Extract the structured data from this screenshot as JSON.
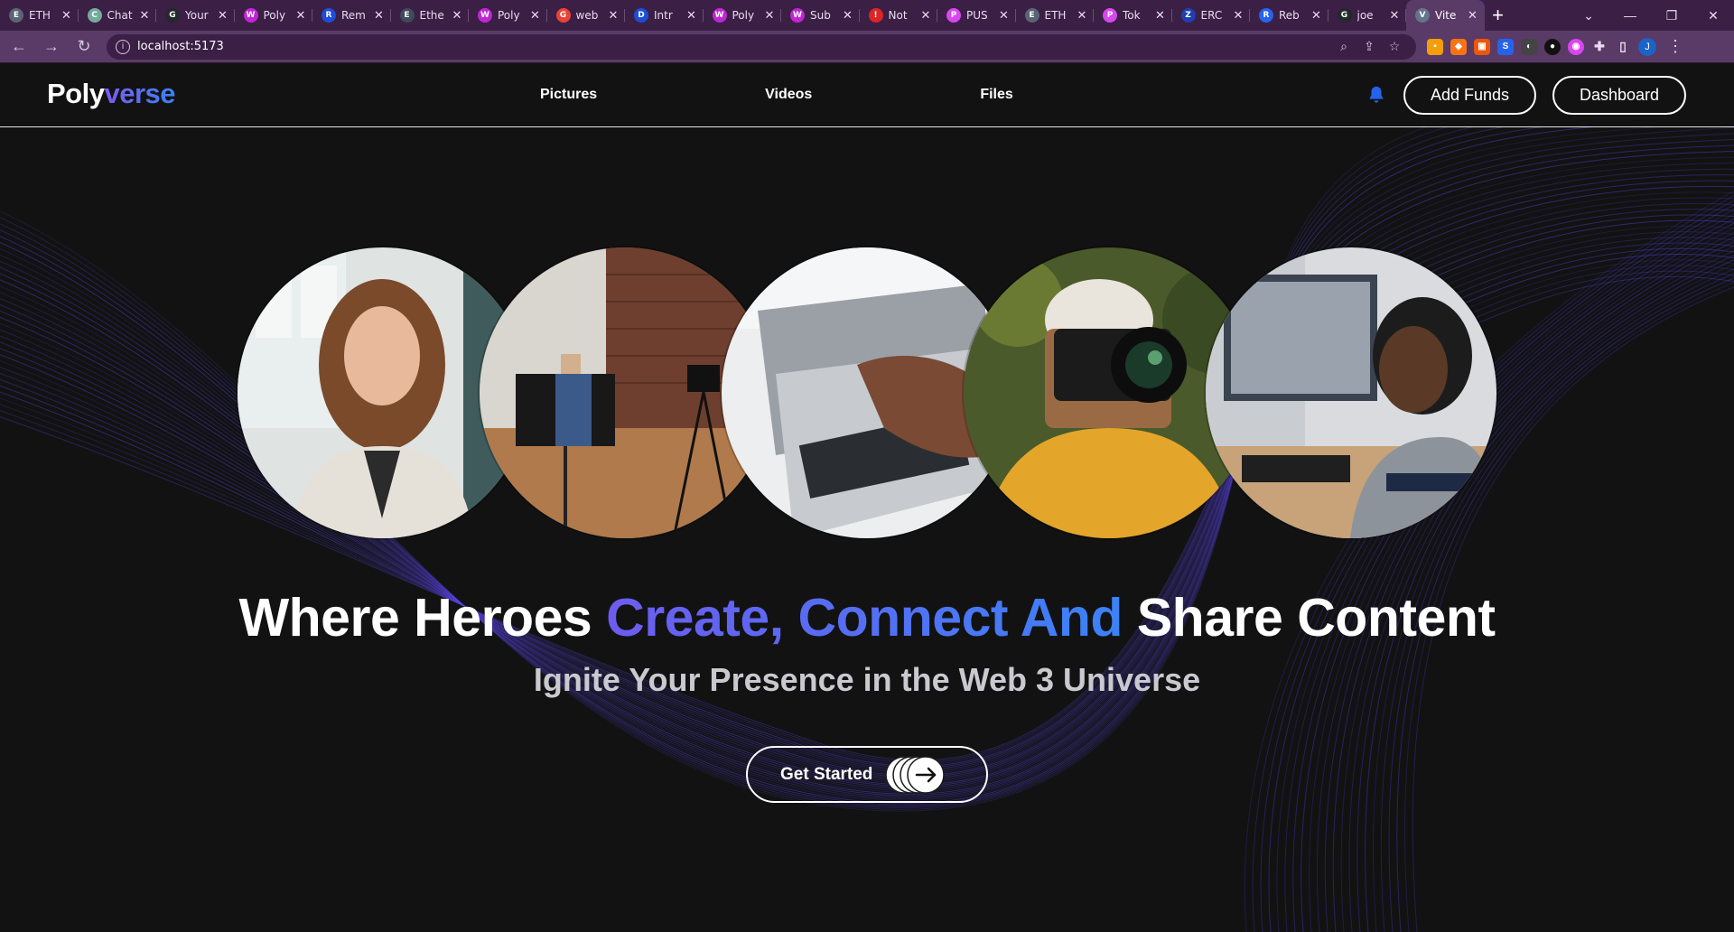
{
  "browser": {
    "tabs": [
      {
        "title": "ETH",
        "favicon_color": "#5a6473",
        "favicon_glyph": "E"
      },
      {
        "title": "Chat",
        "favicon_color": "#74aa9c",
        "favicon_glyph": "C"
      },
      {
        "title": "Your",
        "favicon_color": "#24292e",
        "favicon_glyph": "G"
      },
      {
        "title": "Poly",
        "favicon_color": "#c026d3",
        "favicon_glyph": "W"
      },
      {
        "title": "Rem",
        "favicon_color": "#1d4ed8",
        "favicon_glyph": "R"
      },
      {
        "title": "Ethe",
        "favicon_color": "#3f4a5a",
        "favicon_glyph": "E"
      },
      {
        "title": "Poly",
        "favicon_color": "#c026d3",
        "favicon_glyph": "W"
      },
      {
        "title": "web",
        "favicon_color": "#ea4335",
        "favicon_glyph": "G"
      },
      {
        "title": "Intr",
        "favicon_color": "#1d4ed8",
        "favicon_glyph": "D"
      },
      {
        "title": "Poly",
        "favicon_color": "#c026d3",
        "favicon_glyph": "W"
      },
      {
        "title": "Sub",
        "favicon_color": "#c026d3",
        "favicon_glyph": "W"
      },
      {
        "title": "Not",
        "favicon_color": "#dc2626",
        "favicon_glyph": "!"
      },
      {
        "title": "PUS",
        "favicon_color": "#d946ef",
        "favicon_glyph": "P"
      },
      {
        "title": "ETH",
        "favicon_color": "#5a6473",
        "favicon_glyph": "E"
      },
      {
        "title": "Tok",
        "favicon_color": "#d946ef",
        "favicon_glyph": "P"
      },
      {
        "title": "ERC",
        "favicon_color": "#1e40af",
        "favicon_glyph": "Z"
      },
      {
        "title": "Reb",
        "favicon_color": "#2563eb",
        "favicon_glyph": "R"
      },
      {
        "title": "joe",
        "favicon_color": "#24292e",
        "favicon_glyph": "G"
      },
      {
        "title": "Vite",
        "favicon_color": "#64748b",
        "favicon_glyph": "V"
      }
    ],
    "url": "localhost:5173",
    "profile_initial": "J"
  },
  "site": {
    "logo_part1": "Poly",
    "logo_part2": "verse",
    "nav": {
      "pictures": "Pictures",
      "videos": "Videos",
      "files": "Files"
    },
    "add_funds_label": "Add Funds",
    "dashboard_label": "Dashboard",
    "accent_color": "#3b82f6",
    "secondary_accent": "#6d5cf0"
  },
  "hero": {
    "headline_part1": "Where Heroes ",
    "headline_part2": "Create, Connect And",
    "headline_part3": " Share Content",
    "subheadline": "Ignite Your Presence in the Web 3 Universe",
    "cta_label": "Get Started"
  }
}
